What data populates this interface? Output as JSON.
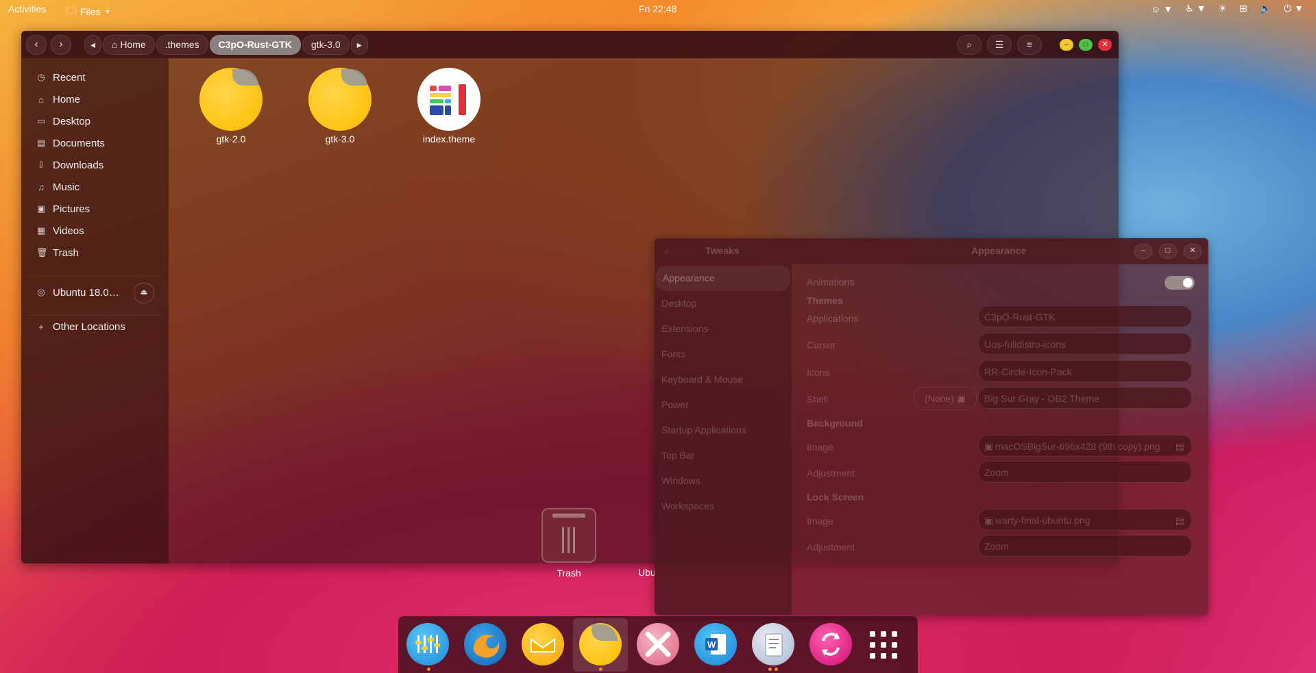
{
  "topbar": {
    "activities": "Activities",
    "files_menu": "Files",
    "clock": "Fri 22:48"
  },
  "files": {
    "breadcrumbs": [
      "Home",
      ".themes",
      "C3pO-Rust-GTK",
      "gtk-3.0"
    ],
    "active_crumb": "C3pO-Rust-GTK",
    "sidebar": [
      {
        "label": "Recent",
        "icon": "clock-icon"
      },
      {
        "label": "Home",
        "icon": "home-icon"
      },
      {
        "label": "Desktop",
        "icon": "desktop-icon"
      },
      {
        "label": "Documents",
        "icon": "document-icon"
      },
      {
        "label": "Downloads",
        "icon": "download-icon"
      },
      {
        "label": "Music",
        "icon": "music-icon"
      },
      {
        "label": "Pictures",
        "icon": "picture-icon"
      },
      {
        "label": "Videos",
        "icon": "video-icon"
      },
      {
        "label": "Trash",
        "icon": "trash-icon"
      }
    ],
    "device": "Ubuntu 18.0…",
    "other_locations": "Other Locations",
    "items": [
      {
        "name": "gtk-2.0",
        "kind": "folder"
      },
      {
        "name": "gtk-3.0",
        "kind": "folder"
      },
      {
        "name": "index.theme",
        "kind": "theme-file"
      }
    ]
  },
  "tweaks": {
    "app_title": "Tweaks",
    "page_title": "Appearance",
    "sidebar": [
      "Appearance",
      "Desktop",
      "Extensions",
      "Fonts",
      "Keyboard & Mouse",
      "Power",
      "Startup Applications",
      "Top Bar",
      "Windows",
      "Workspaces"
    ],
    "animations_label": "Animations",
    "animations_on": true,
    "themes_heading": "Themes",
    "applications_label": "Applications",
    "applications_value": "C3pO-Rust-GTK",
    "cursor_label": "Cursor",
    "cursor_value": "Uos-fulldistro-icons",
    "icons_label": "Icons",
    "icons_value": "RR-Circle-Icon-Pack",
    "shell_label": "Shell",
    "shell_none": "(None)",
    "shell_value": "Big Sur Gray - OB2 Theme",
    "background_heading": "Background",
    "bg_image_label": "Image",
    "bg_image_value": "macOSBigSur-696x428 (9th copy).png",
    "bg_adjust_label": "Adjustment",
    "bg_adjust_value": "Zoom",
    "lock_heading": "Lock Screen",
    "lock_image_label": "Image",
    "lock_image_value": "warty-final-ubuntu.png",
    "lock_adjust_label": "Adjustment",
    "lock_adjust_value": "Zoom"
  },
  "desktop": {
    "trash_label": "Trash",
    "ubuntu_label": "Ubu"
  },
  "dock": {
    "apps": [
      "mixer",
      "firefox",
      "mail",
      "files",
      "crossed-app",
      "word",
      "text-editor",
      "sync-app"
    ],
    "show_apps": "show-apps"
  },
  "colors": {
    "accent_folder": "#ffc619",
    "close": "#e5313c",
    "minimize": "#f4c62d",
    "maximize": "#4fc24a"
  }
}
